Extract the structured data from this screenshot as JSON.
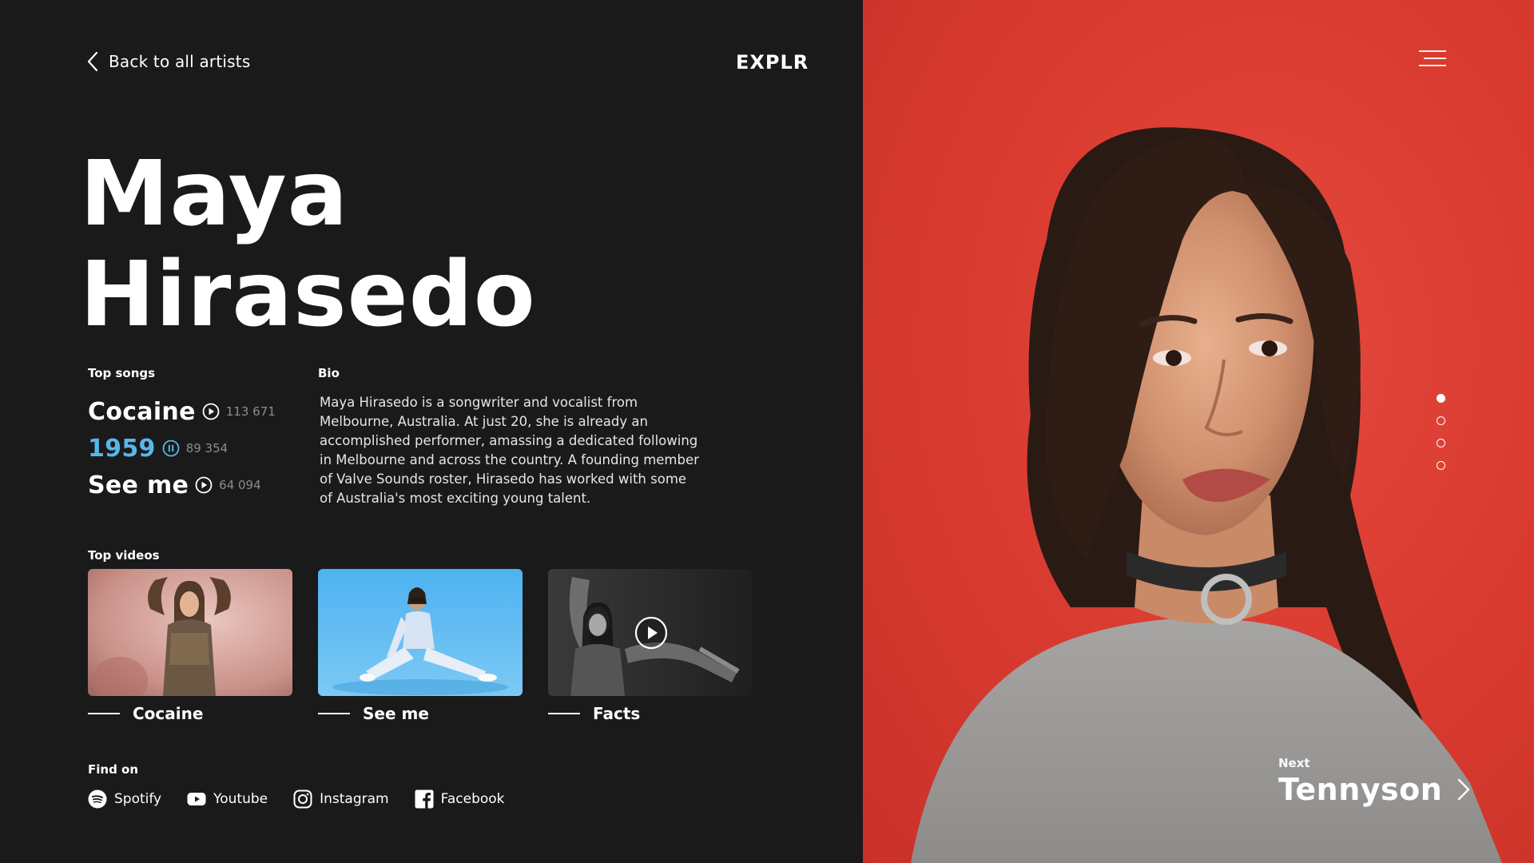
{
  "header": {
    "back_label": "Back to all artists",
    "logo": "EXPLR"
  },
  "artist": {
    "first_name": "Maya",
    "last_name": "Hirasedo"
  },
  "top_songs": {
    "label": "Top songs",
    "items": [
      {
        "title": "Cocaine",
        "plays": "113 671",
        "state": "play"
      },
      {
        "title": "1959",
        "plays": "89 354",
        "state": "pause"
      },
      {
        "title": "See me",
        "plays": "64 094",
        "state": "play"
      }
    ]
  },
  "bio": {
    "label": "Bio",
    "text": "Maya Hirasedo is a songwriter and vocalist from Melbourne, Australia. At just 20, she is already an accomplished performer, amassing a dedicated following in Melbourne and across the country. A founding member of Valve Sounds roster, Hirasedo has worked with some of Australia's most exciting young talent."
  },
  "top_videos": {
    "label": "Top videos",
    "items": [
      {
        "title": "Cocaine"
      },
      {
        "title": "See me"
      },
      {
        "title": "Facts"
      }
    ]
  },
  "find_on": {
    "label": "Find on",
    "items": [
      {
        "name": "Spotify",
        "icon": "spotify-icon"
      },
      {
        "name": "Youtube",
        "icon": "youtube-icon"
      },
      {
        "name": "Instagram",
        "icon": "instagram-icon"
      },
      {
        "name": "Facebook",
        "icon": "facebook-icon"
      }
    ]
  },
  "next": {
    "label": "Next",
    "name": "Tennyson"
  },
  "colors": {
    "background": "#1a1a1b",
    "accent": "#58b7e8",
    "hero_red": "#d83a30"
  }
}
